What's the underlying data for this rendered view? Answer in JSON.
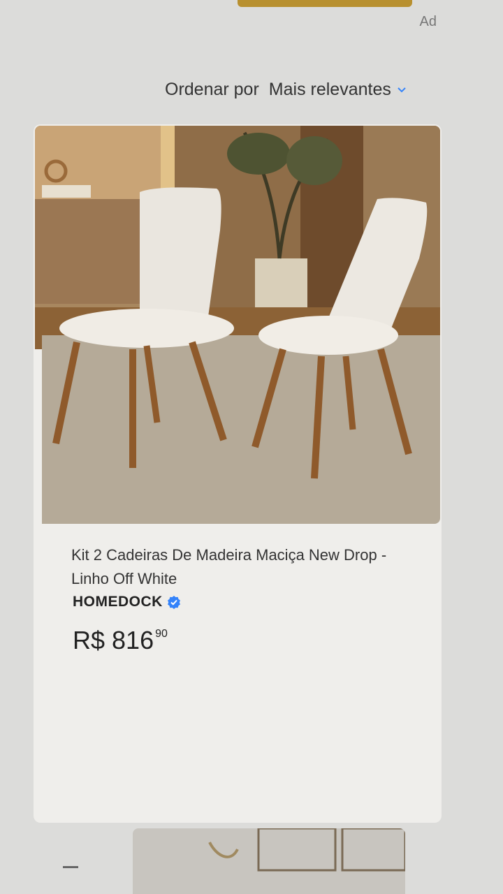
{
  "ad_label": "Ad",
  "sort": {
    "label": "Ordenar por",
    "value": "Mais relevantes",
    "icon": "chevron-down-icon",
    "accent_color": "#3483fa"
  },
  "product": {
    "title": "Kit 2 Cadeiras De Madeira Maciça New Drop - Linho Off White",
    "seller": "HOMEDOCK",
    "verified_icon": "verified-check-icon",
    "price_main": "R$ 816",
    "price_cents": "90",
    "image_alt": "Duas cadeiras estofadas brancas com pés de madeira"
  }
}
